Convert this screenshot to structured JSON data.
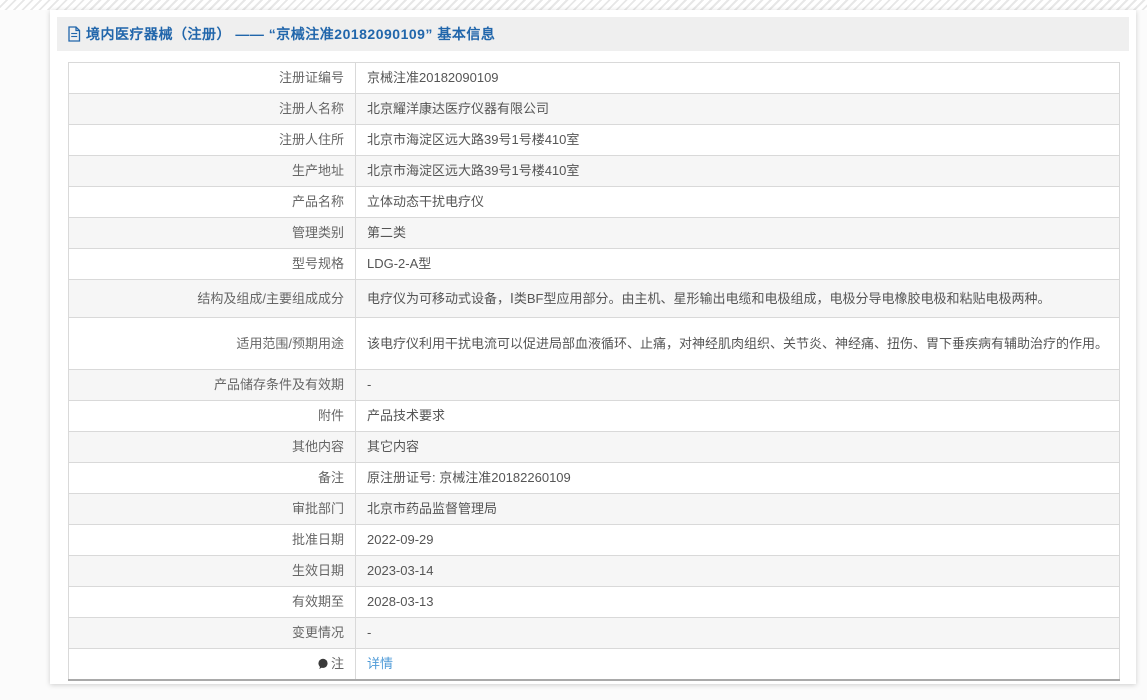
{
  "header": {
    "title": "境内医疗器械（注册） —— “京械注准20182090109” 基本信息",
    "icon": "document-icon"
  },
  "colors": {
    "title_blue": "#2166ab",
    "link_blue": "#4f9bd8",
    "header_bar_bg": "#efefef",
    "row_alt_bg": "#f6f6f6",
    "border_gray": "#d9d9d9",
    "text_gray": "#555555"
  },
  "table": {
    "rows": [
      {
        "label": "注册证编号",
        "value": "京械注准20182090109"
      },
      {
        "label": "注册人名称",
        "value": "北京耀洋康达医疗仪器有限公司"
      },
      {
        "label": "注册人住所",
        "value": "北京市海淀区远大路39号1号楼410室"
      },
      {
        "label": "生产地址",
        "value": "北京市海淀区远大路39号1号楼410室"
      },
      {
        "label": "产品名称",
        "value": "立体动态干扰电疗仪"
      },
      {
        "label": "管理类别",
        "value": "第二类"
      },
      {
        "label": "型号规格",
        "value": "LDG-2-A型"
      },
      {
        "label": "结构及组成/主要组成成分",
        "value": "电疗仪为可移动式设备，Ⅰ类BF型应用部分。由主机、星形输出电缆和电极组成，电极分导电橡胶电极和粘贴电极两种。"
      },
      {
        "label": "适用范围/预期用途",
        "value": "该电疗仪利用干扰电流可以促进局部血液循环、止痛，对神经肌肉组织、关节炎、神经痛、扭伤、胃下垂疾病有辅助治疗的作用。"
      },
      {
        "label": "产品储存条件及有效期",
        "value": "-"
      },
      {
        "label": "附件",
        "value": "产品技术要求"
      },
      {
        "label": "其他内容",
        "value": "其它内容"
      },
      {
        "label": "备注",
        "value": "原注册证号: 京械注准20182260109"
      },
      {
        "label": "审批部门",
        "value": "北京市药品监督管理局"
      },
      {
        "label": "批准日期",
        "value": "2022-09-29"
      },
      {
        "label": "生效日期",
        "value": "2023-03-14"
      },
      {
        "label": "有效期至",
        "value": "2028-03-13"
      },
      {
        "label": "变更情况",
        "value": "-"
      },
      {
        "label": "注",
        "value": "详情",
        "value_is_link": true,
        "label_icon": "note-icon"
      }
    ]
  }
}
